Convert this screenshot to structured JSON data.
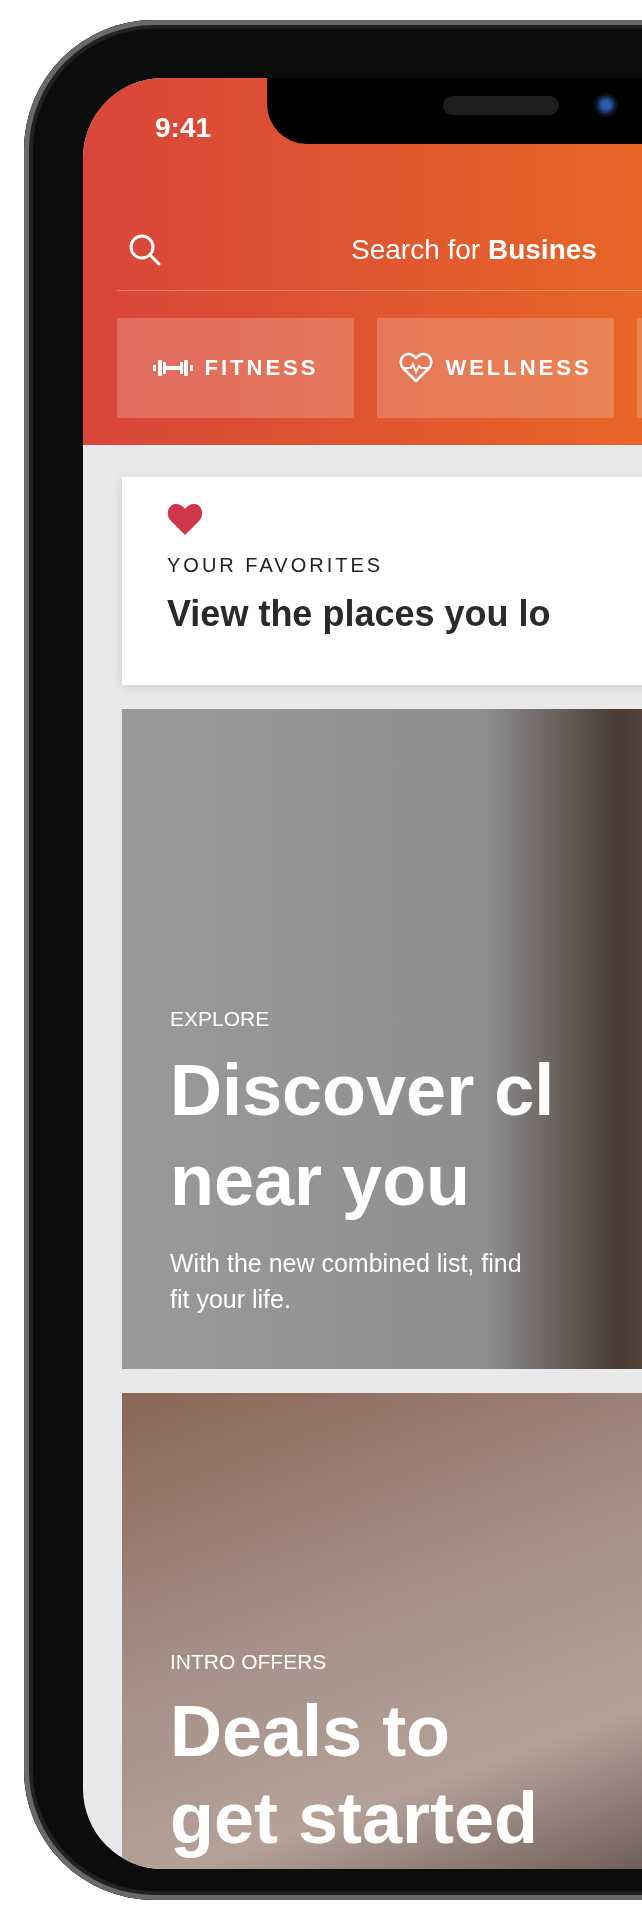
{
  "status_bar": {
    "time": "9:41"
  },
  "search": {
    "placeholder": "Search for **Busines**"
  },
  "categories": [
    {
      "kind": "fitness",
      "label": "FITNESS"
    },
    {
      "kind": "wellness",
      "label": "WELLNESS"
    },
    {
      "kind": "more"
    }
  ],
  "favorites": {
    "eyebrow": "YOUR FAVORITES",
    "title": "View the places you lo"
  },
  "cards": [
    {
      "kind": "explore",
      "eyebrow": "EXPLORE",
      "title_lines": [
        "Discover cl",
        "near you"
      ],
      "description_lines": [
        "With the new combined list, find",
        "fit your life."
      ]
    },
    {
      "kind": "intro",
      "eyebrow": "INTRO OFFERS",
      "title_lines": [
        "Deals to",
        "get started"
      ]
    }
  ]
}
